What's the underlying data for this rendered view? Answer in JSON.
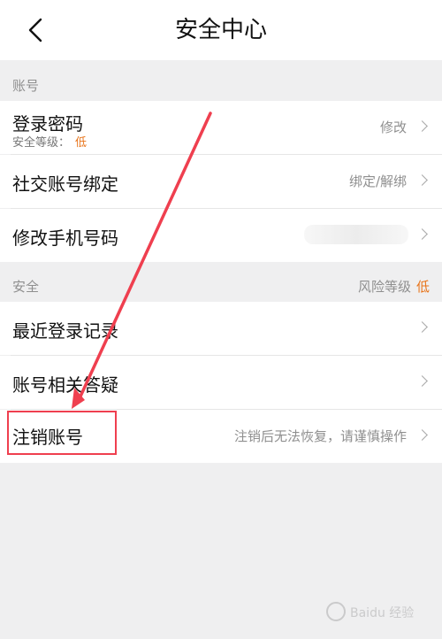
{
  "header": {
    "title": "安全中心"
  },
  "sections": {
    "account_label": "账号",
    "security_label": "安全",
    "security_risk_label": "风险等级",
    "security_risk_value": "低"
  },
  "rows": {
    "login_password": {
      "label": "登录密码",
      "sub_label": "安全等级：",
      "sub_value": "低",
      "right_text": "修改"
    },
    "social_binding": {
      "label": "社交账号绑定",
      "right_text": "绑定/解绑"
    },
    "change_phone": {
      "label": "修改手机号码"
    },
    "recent_login": {
      "label": "最近登录记录"
    },
    "account_faq": {
      "label": "账号相关答疑"
    },
    "cancel_account": {
      "label": "注销账号",
      "right_text": "注销后无法恢复，请谨慎操作"
    }
  },
  "colors": {
    "accent_orange": "#e8741a",
    "annotation_red": "#ef3f4f",
    "background": "#efeff0"
  },
  "icons": {
    "back": "chevron-left-icon",
    "row_chevron": "chevron-right-icon",
    "watermark_logo": "baidu-jingyan-logo"
  },
  "watermark": {
    "text": "Baidu 经验"
  }
}
